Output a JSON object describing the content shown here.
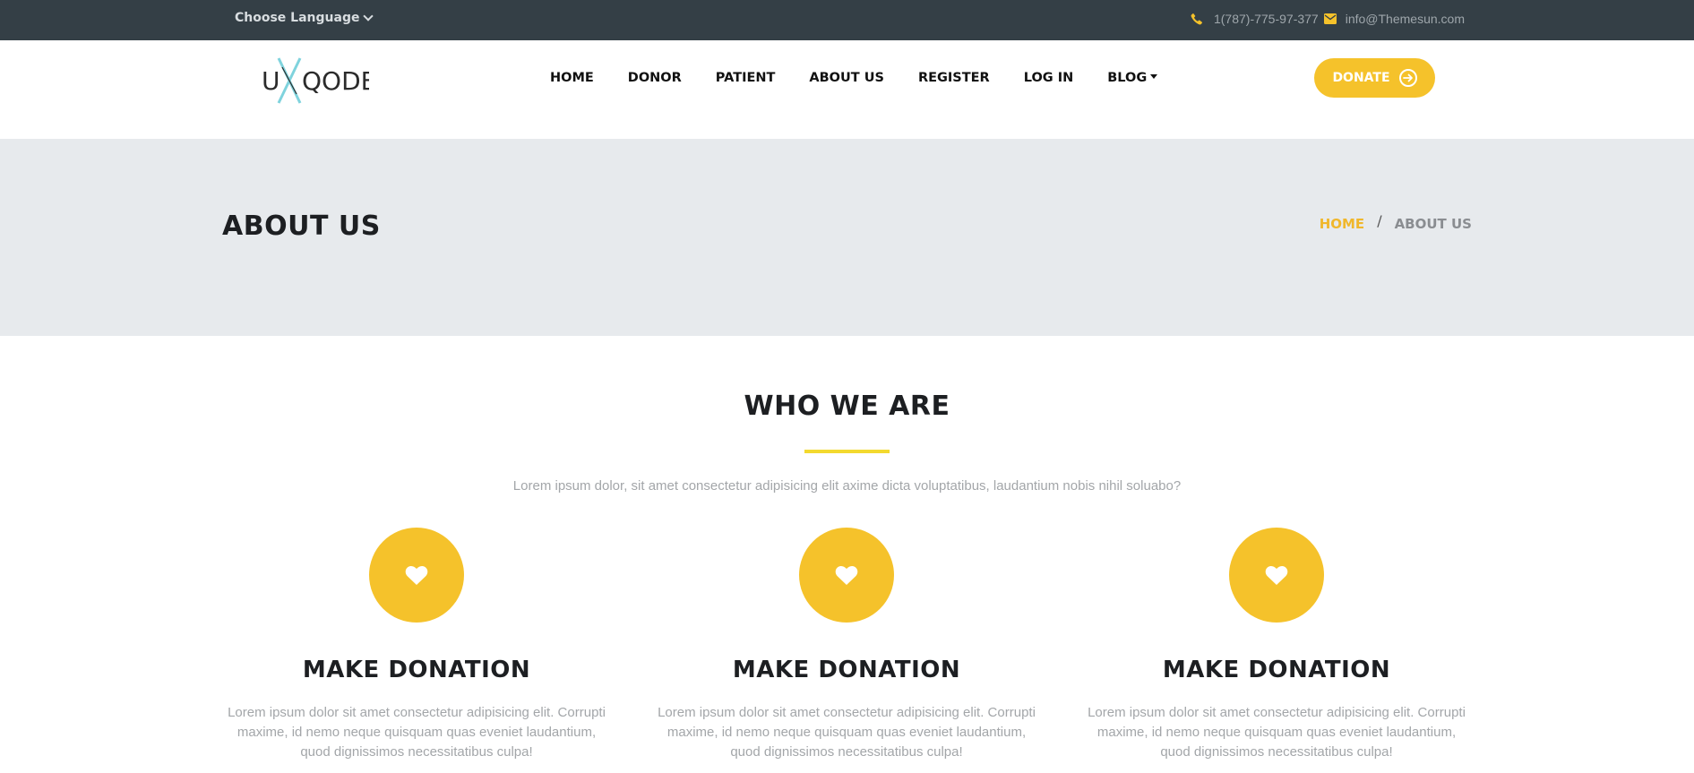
{
  "topbar": {
    "language_label": "Choose Language",
    "phone": "1(787)-775-97-377",
    "email": "info@Themesun.com"
  },
  "header": {
    "logo_text": "UXQODE",
    "nav": [
      {
        "label": "HOME"
      },
      {
        "label": "DONOR"
      },
      {
        "label": "PATIENT"
      },
      {
        "label": "ABOUT US"
      },
      {
        "label": "REGISTER"
      },
      {
        "label": "LOG IN"
      },
      {
        "label": "BLOG"
      }
    ],
    "donate_label": "DONATE"
  },
  "banner": {
    "title": "ABOUT US",
    "breadcrumb": {
      "home": "HOME",
      "separator": "/",
      "current": "ABOUT US"
    }
  },
  "who": {
    "title": "WHO WE ARE",
    "intro": "Lorem ipsum dolor, sit amet consectetur adipisicing elit axime dicta voluptatibus, laudantium nobis nihil soluabo?",
    "cards": [
      {
        "icon": "heart-icon",
        "title": "MAKE DONATION",
        "text": "Lorem ipsum dolor sit amet consectetur adipisicing elit. Corrupti maxime, id nemo neque quisquam quas eveniet laudantium, quod dignissimos necessitatibus culpa!"
      },
      {
        "icon": "heart-icon",
        "title": "MAKE DONATION",
        "text": "Lorem ipsum dolor sit amet consectetur adipisicing elit. Corrupti maxime, id nemo neque quisquam quas eveniet laudantium, quod dignissimos necessitatibus culpa!"
      },
      {
        "icon": "heart-icon",
        "title": "MAKE DONATION",
        "text": "Lorem ipsum dolor sit amet consectetur adipisicing elit. Corrupti maxime, id nemo neque quisquam quas eveniet laudantium, quod dignissimos necessitatibus culpa!"
      }
    ]
  },
  "colors": {
    "topbar": "#343f46",
    "accent": "#f5c22b",
    "breadcrumb_home": "#f0b72c",
    "banner_bg": "#e7eaed",
    "underline": "#f3d92f"
  }
}
